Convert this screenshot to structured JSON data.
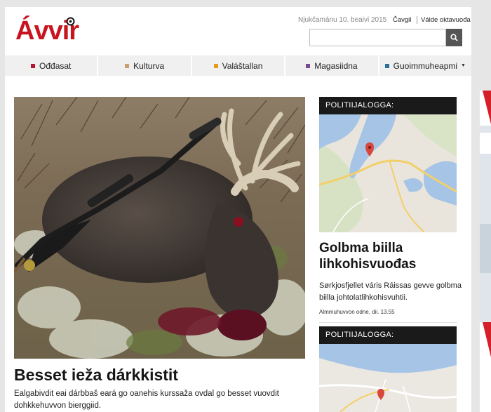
{
  "site": {
    "logo_text": "Ávvir",
    "brand_color": "#c8141e"
  },
  "header": {
    "date": "Njukčamánu 10. beaivi 2015",
    "subscribe_label": "Čavgil",
    "choose_label": "Válde oktavuođa",
    "search_placeholder": "",
    "search_icon": "search-icon"
  },
  "nav": {
    "items": [
      {
        "label": "Ođđasat",
        "color": "#b5172f"
      },
      {
        "label": "Kulturva",
        "color": "#c8a070"
      },
      {
        "label": "Valáštallan",
        "color": "#e59a1f"
      },
      {
        "label": "Magasiidna",
        "color": "#7a4a8c"
      },
      {
        "label": "Guoimmuheapmi",
        "color": "#2a6fa0"
      }
    ]
  },
  "lead_story": {
    "title": "Besset ieža dárkkistit",
    "summary": "Ealgabivdit eai dárbbaš eará go oanehis kurssaža ovdal go besset vuovdit dohkkehuvvon bierggiid."
  },
  "side_stories": [
    {
      "category": "POLITIIJALOGGA:",
      "title": "Golbma biilla lihkohisvuođas",
      "summary": "Sørkjosfjellet váris Ráissas gevve golbma biilla johtolatlihkohisvuhtii.",
      "time": "Almmuhuvvon odne, dii. 13.55"
    },
    {
      "category": "POLITIIJALOGGA:"
    }
  ]
}
